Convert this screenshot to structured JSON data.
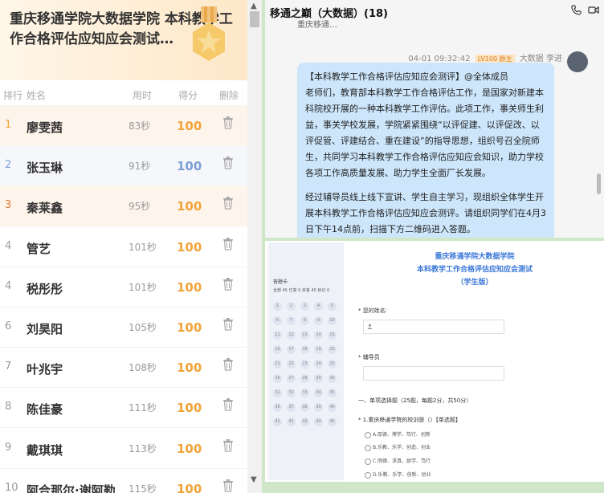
{
  "leaderboard": {
    "title": "重庆移通学院大数据学院 本科教学工作合格评估应知应会测试…",
    "columns": [
      "排行",
      "姓名",
      "用时",
      "得分",
      "删除"
    ],
    "rows": [
      {
        "rank": "1",
        "name": "廖雯茜",
        "time": "83秒",
        "score": "100",
        "rank_color": "#f2a33a",
        "score_color": "#f2a33a"
      },
      {
        "rank": "2",
        "name": "张玉琳",
        "time": "91秒",
        "score": "100",
        "rank_color": "#7d9fd6",
        "score_color": "#7d9fd6"
      },
      {
        "rank": "3",
        "name": "秦莱鑫",
        "time": "95秒",
        "score": "100",
        "rank_color": "#e07b39",
        "score_color": "#f2a33a"
      },
      {
        "rank": "4",
        "name": "管艺",
        "time": "101秒",
        "score": "100",
        "rank_color": "#999999",
        "score_color": "#f2a33a"
      },
      {
        "rank": "4",
        "name": "税彤彤",
        "time": "101秒",
        "score": "100",
        "rank_color": "#999999",
        "score_color": "#f2a33a"
      },
      {
        "rank": "6",
        "name": "刘昊阳",
        "time": "105秒",
        "score": "100",
        "rank_color": "#999999",
        "score_color": "#f2a33a"
      },
      {
        "rank": "7",
        "name": "叶兆宇",
        "time": "108秒",
        "score": "100",
        "rank_color": "#999999",
        "score_color": "#f2a33a"
      },
      {
        "rank": "8",
        "name": "陈佳豪",
        "time": "111秒",
        "score": "100",
        "rank_color": "#999999",
        "score_color": "#f2a33a"
      },
      {
        "rank": "9",
        "name": "戴琪琪",
        "time": "113秒",
        "score": "100",
        "rank_color": "#999999",
        "score_color": "#f2a33a"
      },
      {
        "rank": "10",
        "name": "阿合那尔·谢阿勒",
        "time": "115秒",
        "score": "100",
        "rank_color": "#999999",
        "score_color": "#f2a33a"
      }
    ]
  },
  "chat": {
    "title": "移通之巅（大数据）(18)",
    "prev_text": "重庆移通…",
    "time": "04-01 09:32:42",
    "badge": "LV100 群主",
    "sender": "大数据 李进",
    "paragraphs": [
      "【本科教学工作合格评估应知应会测评】@全体成员",
      "老师们，教育部本科教学工作合格评估工作，是国家对新建本科院校开展的一种本科教学工作评估。此项工作，事关师生利益，事关学校发展，学院紧紧围绕“以评促建、以评促改、以评促管、评建结合、重在建设”的指导思想，组织号召全院师生，共同学习本科教学工作合格评估应知应会知识，助力学校各项工作高质量发展、助力学生全面厂长发展。",
      "经过辅导员线上线下宣讲、学生自主学习，现组织全体学生开展本科教学工作合格评估应知应会测评。请组织同学们在4月3日下午14点前，扫描下方二维码进入答题。"
    ]
  },
  "form": {
    "title1": "重庆移通学院大数据学院",
    "title2": "本科教学工作合格评估应知应会测试",
    "title3": "（学生版）",
    "card_title": "答题卡",
    "card_stats": "全部 45  已答 0  未答 45  标记 0",
    "numbers": [
      "1",
      "2",
      "3",
      "4",
      "5",
      "6",
      "7",
      "8",
      "9",
      "10",
      "11",
      "12",
      "13",
      "14",
      "15",
      "16",
      "17",
      "18",
      "19",
      "20",
      "21",
      "22",
      "23",
      "24",
      "25",
      "26",
      "27",
      "28",
      "29",
      "30",
      "31",
      "32",
      "33",
      "34",
      "35",
      "36",
      "37",
      "38",
      "39",
      "40",
      "41",
      "42",
      "43",
      "44",
      "45"
    ],
    "name_label": "* 您的姓名:",
    "counselor_label": "* 辅导员",
    "section": "一、单项选择题（25题，每题2分，共50分）",
    "question": "* 1.重庆移通学院的校训是（）【单选题】",
    "options": [
      "A.厚德、博学、笃行、创新",
      "B.乐教、乐学、创造、创业",
      "C.明德、求真、励学、笃行",
      "D.乐教、乐学、创新、创业"
    ]
  }
}
